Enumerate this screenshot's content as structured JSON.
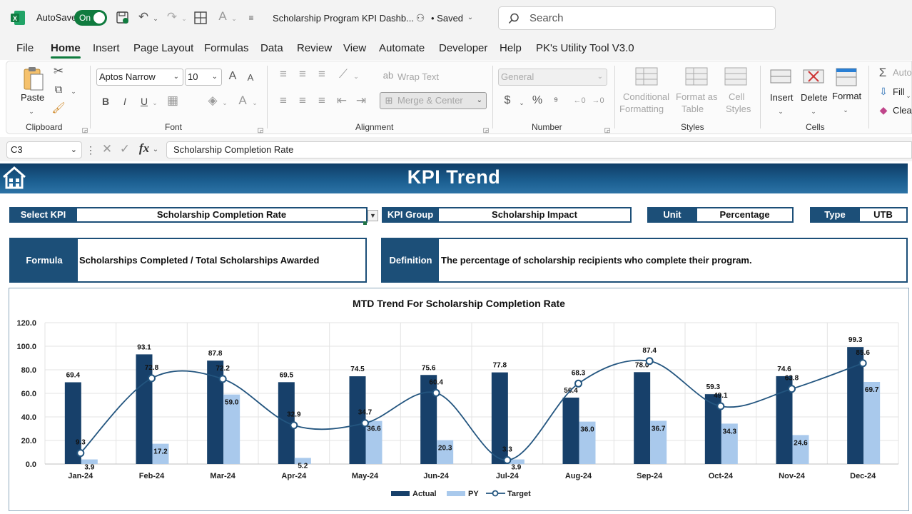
{
  "titlebar": {
    "autosave_label": "AutoSave",
    "autosave_state": "On",
    "file_title": "Scholarship Program KPI Dashb...",
    "saved_status": "• Saved",
    "search_placeholder": "Search"
  },
  "menu": [
    "File",
    "Home",
    "Insert",
    "Page Layout",
    "Formulas",
    "Data",
    "Review",
    "View",
    "Automate",
    "Developer",
    "Help",
    "PK's Utility Tool V3.0"
  ],
  "ribbon": {
    "clipboard": {
      "paste": "Paste",
      "label": "Clipboard"
    },
    "font": {
      "name": "Aptos Narrow",
      "size": "10",
      "label": "Font",
      "bold": "B",
      "italic": "I",
      "underline": "U"
    },
    "alignment": {
      "wrap_text": "Wrap Text",
      "merge_center": "Merge & Center",
      "label": "Alignment"
    },
    "number": {
      "format": "General",
      "currency": "$",
      "percent": "%",
      "label": "Number"
    },
    "styles": {
      "conditional": "Conditional",
      "formatting": "Formatting",
      "format_as": "Format as",
      "table": "Table",
      "cell": "Cell",
      "styles_word": "Styles",
      "label": "Styles"
    },
    "cells": {
      "insert": "Insert",
      "delete": "Delete",
      "format": "Format",
      "label": "Cells"
    },
    "editing": {
      "autosum": "Auto",
      "fill": "Fill",
      "clear": "Clear"
    }
  },
  "formula_bar": {
    "cell_ref": "C3",
    "content": "Scholarship Completion Rate"
  },
  "dashboard": {
    "title": "KPI Trend",
    "select_kpi_label": "Select KPI",
    "select_kpi_value": "Scholarship Completion Rate",
    "kpi_group_label": "KPI Group",
    "kpi_group_value": "Scholarship Impact",
    "unit_label": "Unit",
    "unit_value": "Percentage",
    "type_label": "Type",
    "type_value": "UTB",
    "formula_label": "Formula",
    "formula_value": "Scholarships Completed / Total Scholarships Awarded",
    "definition_label": "Definition",
    "definition_value": "The percentage of scholarship recipients who complete their program."
  },
  "colors": {
    "actual": "#17406a",
    "py": "#a9c9ec",
    "target": "#23557f",
    "header": "#1c4f78",
    "excel_green": "#0f7b3e"
  },
  "chart_data": {
    "type": "bar",
    "title": "MTD Trend For Scholarship Completion Rate",
    "categories": [
      "Jan-24",
      "Feb-24",
      "Mar-24",
      "Apr-24",
      "May-24",
      "Jun-24",
      "Jul-24",
      "Aug-24",
      "Sep-24",
      "Oct-24",
      "Nov-24",
      "Dec-24"
    ],
    "series": [
      {
        "name": "Actual",
        "kind": "bar",
        "values": [
          69.4,
          93.1,
          87.8,
          69.5,
          74.5,
          75.6,
          77.8,
          56.4,
          78.0,
          59.3,
          74.6,
          99.3
        ]
      },
      {
        "name": "PY",
        "kind": "bar",
        "values": [
          3.9,
          17.2,
          59.0,
          5.2,
          36.6,
          20.3,
          3.9,
          36.0,
          36.7,
          34.3,
          24.6,
          69.7
        ]
      },
      {
        "name": "Target",
        "kind": "line",
        "values": [
          9.3,
          72.8,
          72.2,
          32.9,
          34.7,
          60.4,
          3.3,
          68.3,
          87.4,
          49.1,
          63.8,
          85.6
        ]
      }
    ],
    "ylim": [
      0,
      120
    ],
    "yticks": [
      "0.0",
      "20.0",
      "40.0",
      "60.0",
      "80.0",
      "100.0",
      "120.0"
    ],
    "grid": true,
    "legend": "bottom"
  }
}
